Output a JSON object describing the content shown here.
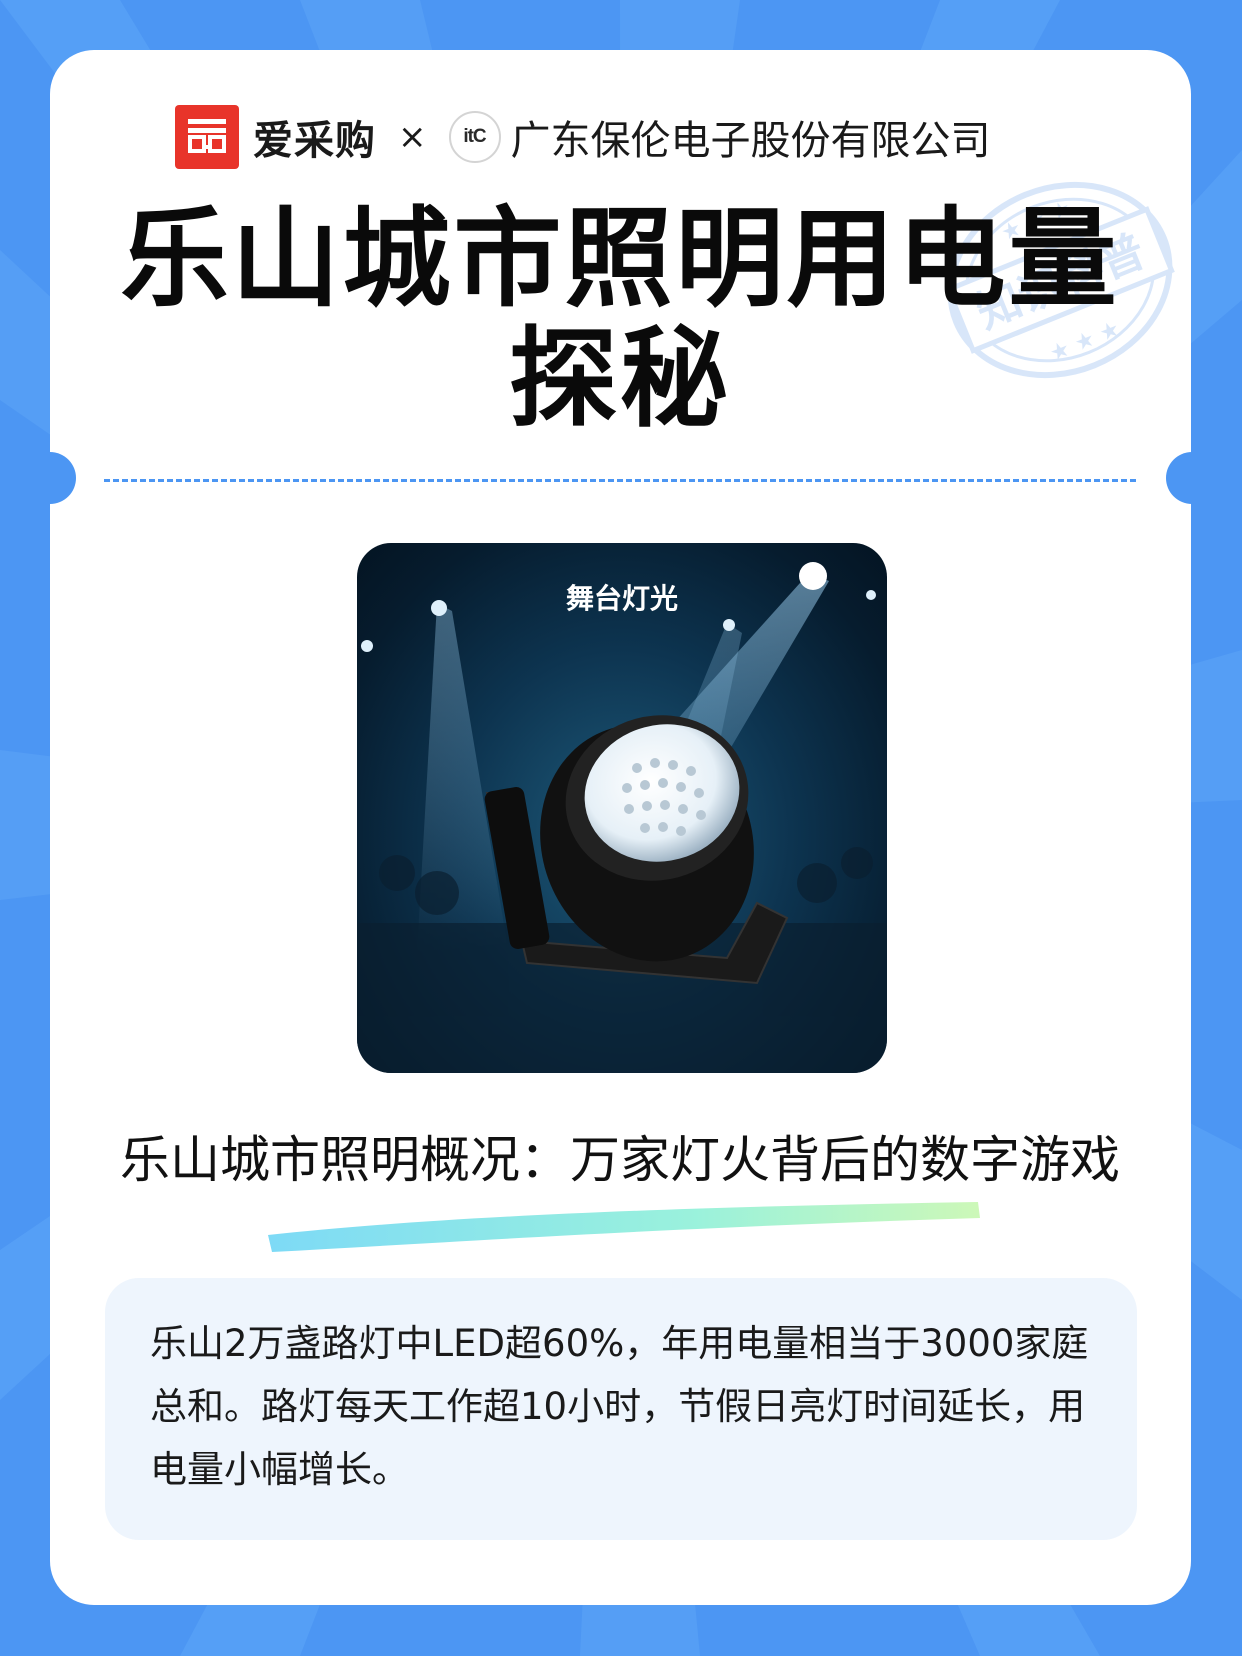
{
  "colors": {
    "background": "#4c96f3",
    "card": "#ffffff",
    "brand_red": "#e8342a",
    "divider": "#4c96f3",
    "info_box": "#eef5fd"
  },
  "header": {
    "brand_logo_icon": "aicaigou-logo-icon",
    "brand_name": "爱采购",
    "separator": "×",
    "partner_logo_text": "itC",
    "company_name": "广东保伦电子股份有限公司"
  },
  "title": "乐山城市照明用电量探秘",
  "stamp": {
    "text": "知识科普",
    "icon": "knowledge-stamp-icon"
  },
  "photo": {
    "caption": "舞台灯光",
    "icon": "stage-light-image"
  },
  "section": {
    "subtitle": "乐山城市照明概况：万家灯火背后的数字游戏",
    "body": "乐山2万盏路灯中LED超60%，年用电量相当于3000家庭总和。路灯每天工作超10小时，节假日亮灯时间延长，用电量小幅增长。"
  }
}
